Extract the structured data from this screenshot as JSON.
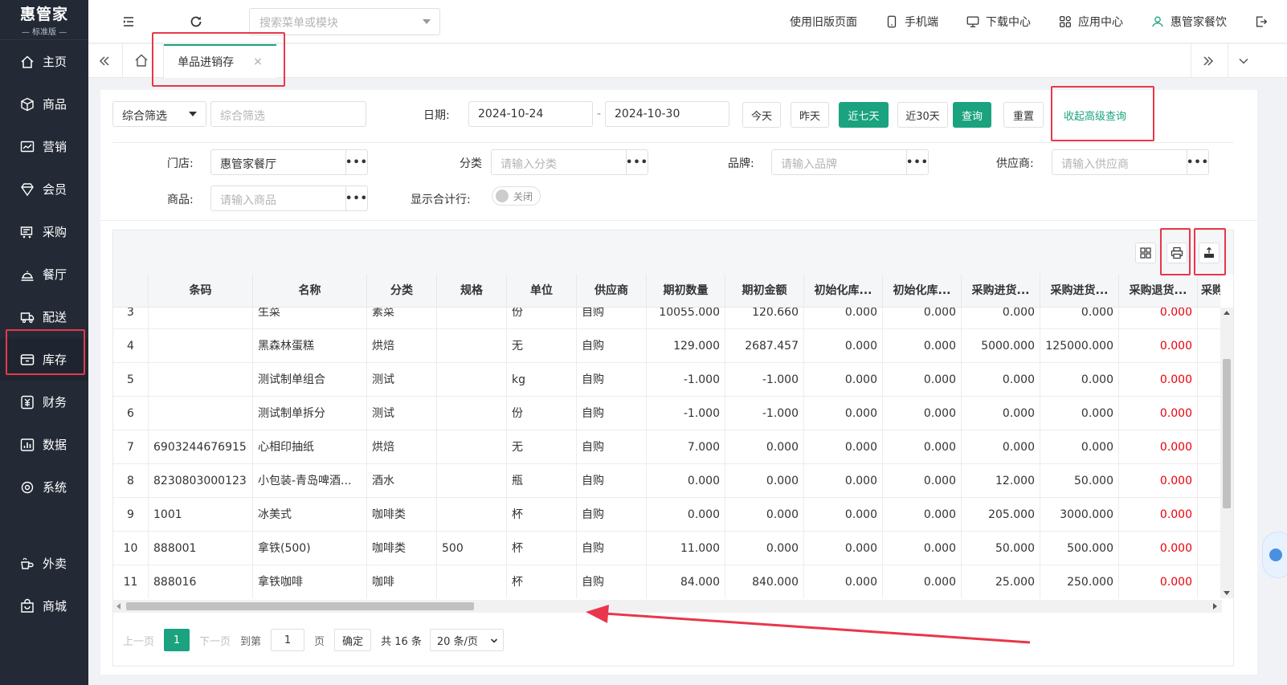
{
  "brand": {
    "name": "惠管家",
    "edition": "— 标准版 —"
  },
  "sidebar": {
    "items": [
      {
        "label": "主页",
        "icon": "home-icon"
      },
      {
        "label": "商品",
        "icon": "cube-icon"
      },
      {
        "label": "营销",
        "icon": "chart-icon"
      },
      {
        "label": "会员",
        "icon": "diamond-icon"
      },
      {
        "label": "采购",
        "icon": "purchase-icon"
      },
      {
        "label": "餐厅",
        "icon": "restaurant-icon"
      },
      {
        "label": "配送",
        "icon": "truck-icon"
      },
      {
        "label": "库存",
        "icon": "inventory-icon"
      },
      {
        "label": "财务",
        "icon": "finance-icon"
      },
      {
        "label": "数据",
        "icon": "data-icon"
      },
      {
        "label": "系统",
        "icon": "gear-icon"
      },
      {
        "label": "外卖",
        "icon": "takeout-icon"
      },
      {
        "label": "商城",
        "icon": "mall-icon"
      }
    ],
    "active_index": 7
  },
  "topbar": {
    "search_placeholder": "搜索菜单或模块",
    "links": [
      {
        "label": "使用旧版页面",
        "icon": ""
      },
      {
        "label": "手机端",
        "icon": "phone-icon"
      },
      {
        "label": "下载中心",
        "icon": "download-icon"
      },
      {
        "label": "应用中心",
        "icon": "apps-icon"
      },
      {
        "label": "惠管家餐饮",
        "icon": "user-icon"
      }
    ]
  },
  "tabs": [
    {
      "label": "单品进销存",
      "close": "×"
    }
  ],
  "filters": {
    "filter_type": "综合筛选",
    "filter_placeholder": "综合筛选",
    "date_label": "日期:",
    "date_start": "2024-10-24",
    "date_sep": "-",
    "date_end": "2024-10-30",
    "quick": [
      "今天",
      "昨天",
      "近七天",
      "近30天"
    ],
    "active_quick": 2,
    "query_label": "查询",
    "reset_label": "重置",
    "collapse_label": "收起高级查询",
    "store_label": "门店:",
    "store_value": "惠管家餐厅",
    "category_label": "分类",
    "category_placeholder": "请输入分类",
    "brand_label": "品牌:",
    "brand_placeholder": "请输入品牌",
    "supplier_label": "供应商:",
    "supplier_placeholder": "请输入供应商",
    "product_label": "商品:",
    "product_placeholder": "请输入商品",
    "total_row_label": "显示合计行:",
    "total_row_value": "关闭",
    "more": "•••"
  },
  "table": {
    "columns": [
      "",
      "条码",
      "名称",
      "分类",
      "规格",
      "单位",
      "供应商",
      "期初数量",
      "期初金额",
      "初始化库...",
      "初始化库...",
      "采购进货...",
      "采购进货...",
      "采购退货...",
      "采购退"
    ],
    "rows": [
      [
        "3",
        "",
        "生菜",
        "素菜",
        "",
        "份",
        "自购",
        "10055.000",
        "120.660",
        "0.000",
        "0.000",
        "0.000",
        "0.000",
        "0.000"
      ],
      [
        "4",
        "",
        "黑森林蛋糕",
        "烘焙",
        "",
        "无",
        "自购",
        "129.000",
        "2687.457",
        "0.000",
        "0.000",
        "5000.000",
        "125000.000",
        "0.000"
      ],
      [
        "5",
        "",
        "测试制单组合",
        "测试",
        "",
        "kg",
        "自购",
        "-1.000",
        "-1.000",
        "0.000",
        "0.000",
        "0.000",
        "0.000",
        "0.000"
      ],
      [
        "6",
        "",
        "测试制单拆分",
        "测试",
        "",
        "份",
        "自购",
        "-1.000",
        "-1.000",
        "0.000",
        "0.000",
        "0.000",
        "0.000",
        "0.000"
      ],
      [
        "7",
        "6903244676915",
        "心相印抽纸",
        "烘焙",
        "",
        "无",
        "自购",
        "7.000",
        "0.000",
        "0.000",
        "0.000",
        "0.000",
        "0.000",
        "0.000"
      ],
      [
        "8",
        "8230803000123",
        "小包装-青岛啤酒...",
        "酒水",
        "",
        "瓶",
        "自购",
        "0.000",
        "0.000",
        "0.000",
        "0.000",
        "12.000",
        "50.000",
        "0.000"
      ],
      [
        "9",
        "1001",
        "冰美式",
        "咖啡类",
        "",
        "杯",
        "自购",
        "0.000",
        "0.000",
        "0.000",
        "0.000",
        "205.000",
        "3000.000",
        "0.000"
      ],
      [
        "10",
        "888001",
        "拿铁(500)",
        "咖啡类",
        "500",
        "杯",
        "自购",
        "11.000",
        "0.000",
        "0.000",
        "0.000",
        "50.000",
        "500.000",
        "0.000"
      ],
      [
        "11",
        "888016",
        "拿铁咖啡",
        "咖啡",
        "",
        "杯",
        "自购",
        "84.000",
        "840.000",
        "0.000",
        "0.000",
        "25.000",
        "250.000",
        "0.000"
      ]
    ]
  },
  "pager": {
    "prev": "上一页",
    "current": "1",
    "next": "下一页",
    "goto": "到第",
    "goto_value": "1",
    "page_unit": "页",
    "confirm": "确定",
    "total": "共 16 条",
    "page_size": "20 条/页"
  },
  "colors": {
    "accent": "#1aa37e",
    "sidebar": "#232a36",
    "highlight": "#e8374b",
    "negative": "#e8000b"
  }
}
